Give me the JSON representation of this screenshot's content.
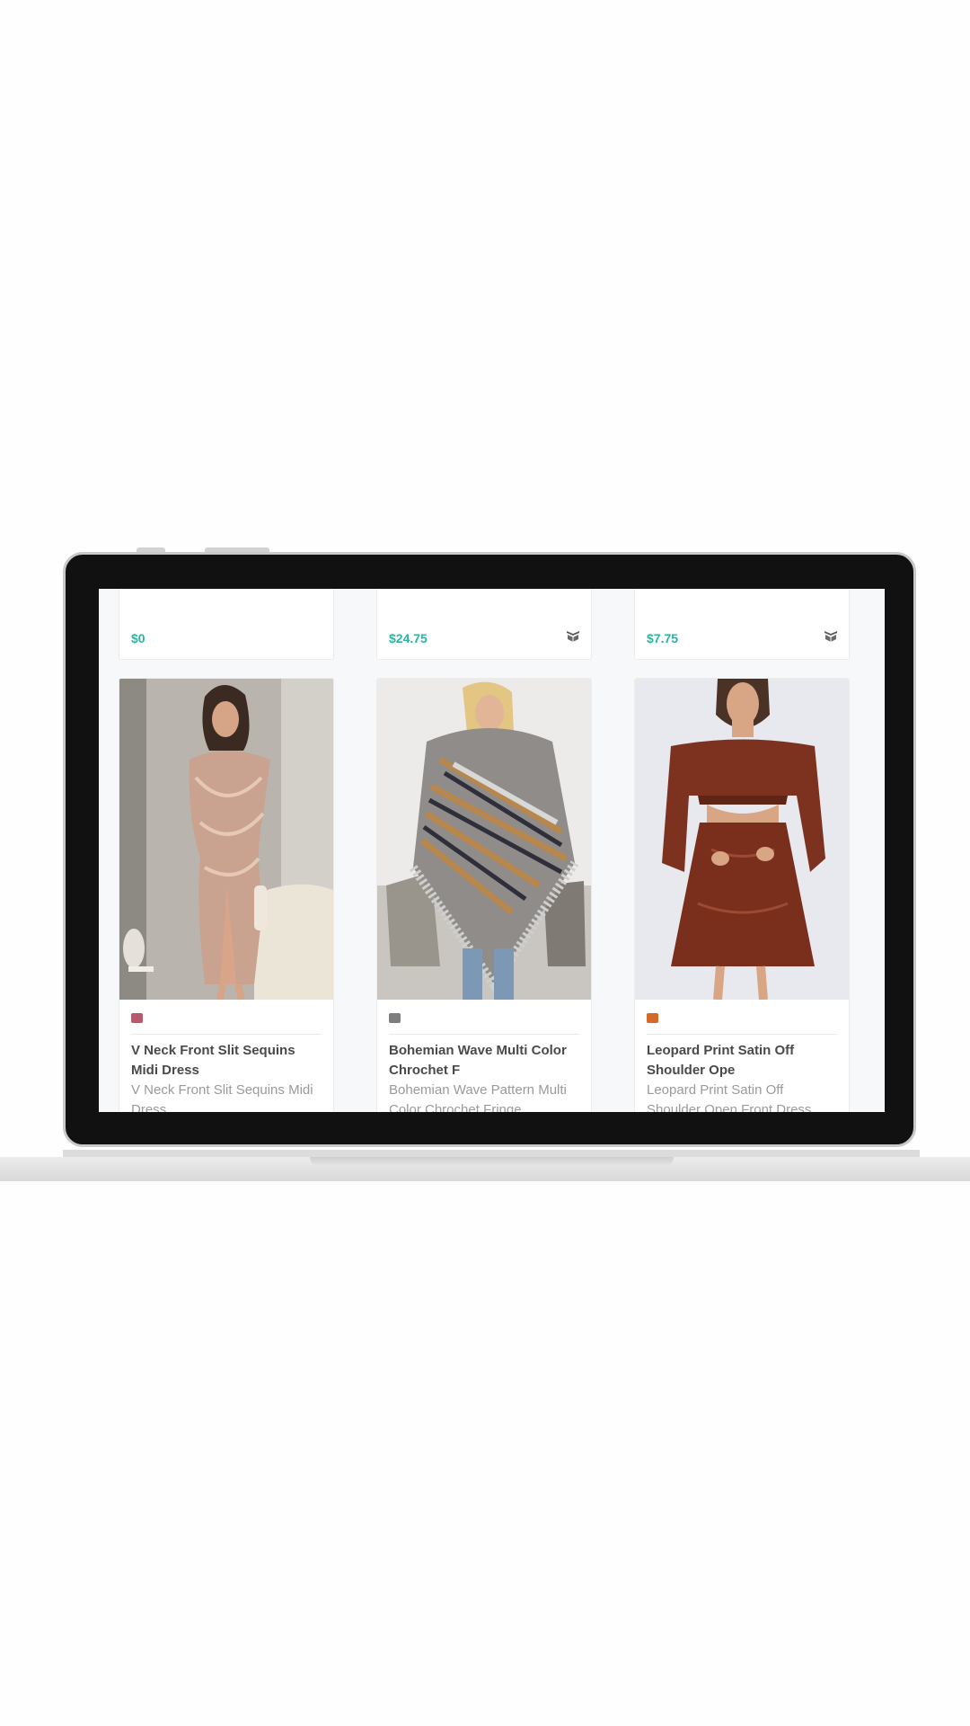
{
  "products_top": [
    {
      "price": "$0",
      "has_cart": false
    },
    {
      "price": "$24.75",
      "has_cart": true
    },
    {
      "price": "$7.75",
      "has_cart": true
    }
  ],
  "products": [
    {
      "title": "V Neck Front Slit Sequins Midi Dress",
      "description": "V Neck Front Slit Sequins Midi Dress",
      "swatch_color": "#b75a6d"
    },
    {
      "title": "Bohemian Wave Multi Color Chrochet F",
      "description": "Bohemian Wave Pattern Multi Color Chrochet Fringe",
      "swatch_color": "#7d7d7d"
    },
    {
      "title": "Leopard Print Satin Off Shoulder Ope",
      "description": "Leopard Print Satin Off Shoulder Open Front Dress",
      "swatch_color": "#d36a2a"
    }
  ],
  "colors": {
    "accent_price": "#2bb3a0",
    "bezel": "#111111",
    "screen_bg": "#f7f8f9"
  },
  "icons": {
    "cart": "cart-icon"
  }
}
